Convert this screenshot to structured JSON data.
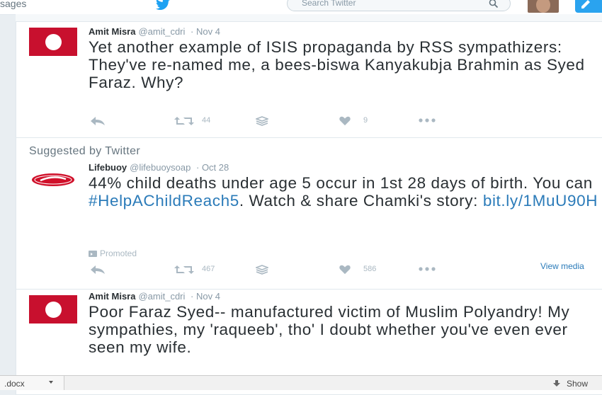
{
  "nav": {
    "messages_label": "sages",
    "search_placeholder": "Search Twitter"
  },
  "colors": {
    "link": "#2b7bb9",
    "brand": "#1da1f2",
    "avatar_red": "#c8102e"
  },
  "icons": [
    "twitter-bird-icon",
    "search-icon",
    "compose-tweet-icon",
    "reply-icon",
    "retweet-icon",
    "stack-icon",
    "heart-icon",
    "more-icon",
    "promoted-icon"
  ],
  "tweets": [
    {
      "name": "Amit Misra",
      "handle": "@amit_cdri",
      "date": "· Nov 4",
      "text": "Yet another example of ISIS propaganda by RSS sympathizers: They've re-named me, a bees-biswa Kanyakubja Brahmin as Syed Faraz. Why?",
      "retweets": "44",
      "likes": "9"
    },
    {
      "suggested_label": "Suggested by Twitter",
      "name": "Lifebuoy",
      "handle": "@lifebuoysoap",
      "date": "· Oct 28",
      "text_start": "44% child deaths under age 5 occur in 1st 28 days of birth. You can ",
      "hashtag": "#HelpAChildReach5",
      "text_mid": ". Watch & share Chamki's story: ",
      "url": "bit.ly/1MuU90H",
      "promoted_label": "Promoted",
      "retweets": "467",
      "likes": "586",
      "view_media": "View media"
    },
    {
      "name": "Amit Misra",
      "handle": "@amit_cdri",
      "date": "· Nov 4",
      "text": "Poor Faraz Syed-- manufactured victim of Muslim Polyandry! My sympathies, my 'raqueeb', tho' I doubt whether you've even ever seen my wife."
    }
  ],
  "downloads": {
    "file_label": ".docx",
    "show_all_label": "Show"
  }
}
